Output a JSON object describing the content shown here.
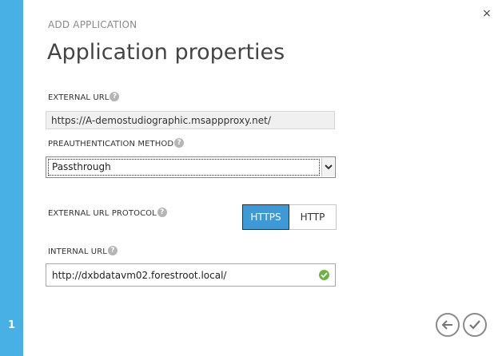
{
  "wizard": {
    "step_number": "1",
    "supertitle": "ADD APPLICATION",
    "title": "Application properties"
  },
  "fields": {
    "external_url": {
      "label": "EXTERNAL URL",
      "value": "https://A-demostudiographic.msappproxy.net/"
    },
    "preauth": {
      "label": "PREAUTHENTICATION METHOD",
      "selected": "Passthrough"
    },
    "protocol": {
      "label": "EXTERNAL URL PROTOCOL",
      "options": [
        "HTTPS",
        "HTTP"
      ],
      "selected": "HTTPS"
    },
    "internal_url": {
      "label": "INTERNAL URL",
      "value": "http://dxbdatavm02.forestroot.local/"
    }
  },
  "icons": {
    "close": "×",
    "help": "?"
  },
  "colors": {
    "rail": "#48b0e4",
    "toggle_active": "#3e9ad6",
    "valid": "#6cb33f"
  }
}
